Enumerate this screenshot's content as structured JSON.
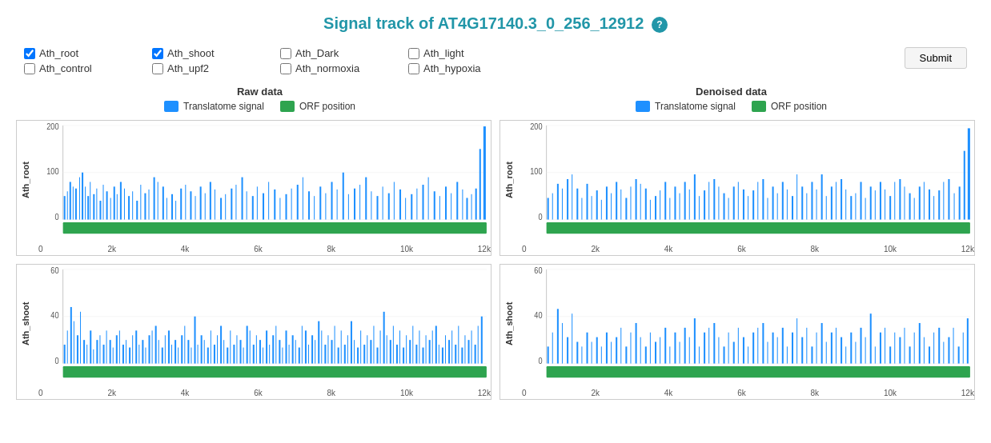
{
  "page": {
    "title": "Signal track of AT4G17140.3_0_256_12912",
    "help_icon": "?",
    "submit_label": "Submit"
  },
  "controls": {
    "groups": [
      {
        "items": [
          {
            "label": "Ath_root",
            "checked": true
          },
          {
            "label": "Ath_control",
            "checked": false
          }
        ]
      },
      {
        "items": [
          {
            "label": "Ath_shoot",
            "checked": true
          },
          {
            "label": "Ath_upf2",
            "checked": false
          }
        ]
      },
      {
        "items": [
          {
            "label": "Ath_Dark",
            "checked": false
          },
          {
            "label": "Ath_normoxia",
            "checked": false
          }
        ]
      },
      {
        "items": [
          {
            "label": "Ath_light",
            "checked": false
          },
          {
            "label": "Ath_hypoxia",
            "checked": false
          }
        ]
      }
    ]
  },
  "legend": {
    "raw_data": {
      "title": "Raw data",
      "items": [
        {
          "label": "Translatome signal",
          "color": "#1e90ff"
        },
        {
          "label": "ORF position",
          "color": "#2ea44f"
        }
      ]
    },
    "denoised_data": {
      "title": "Denoised data",
      "items": [
        {
          "label": "Translatome signal",
          "color": "#1e90ff"
        },
        {
          "label": "ORF position",
          "color": "#2ea44f"
        }
      ]
    }
  },
  "charts": [
    {
      "id": "raw_root",
      "y_label": "Ath_root",
      "y_max": 200,
      "x_labels": [
        "0",
        "2k",
        "4k",
        "6k",
        "8k",
        "10k",
        "12k"
      ],
      "type": "root"
    },
    {
      "id": "denoised_root",
      "y_label": "Ath_root",
      "y_max": 200,
      "x_labels": [
        "0",
        "2k",
        "4k",
        "6k",
        "8k",
        "10k",
        "12k"
      ],
      "type": "root"
    },
    {
      "id": "raw_shoot",
      "y_label": "Ath_shoot",
      "y_max": 60,
      "x_labels": [
        "0",
        "2k",
        "4k",
        "6k",
        "8k",
        "10k",
        "12k"
      ],
      "type": "shoot"
    },
    {
      "id": "denoised_shoot",
      "y_label": "Ath_shoot",
      "y_max": 60,
      "x_labels": [
        "0",
        "2k",
        "4k",
        "6k",
        "8k",
        "10k",
        "12k"
      ],
      "type": "shoot"
    }
  ],
  "colors": {
    "signal": "#1e90ff",
    "orf": "#2ea44f",
    "title": "#2196a8"
  }
}
